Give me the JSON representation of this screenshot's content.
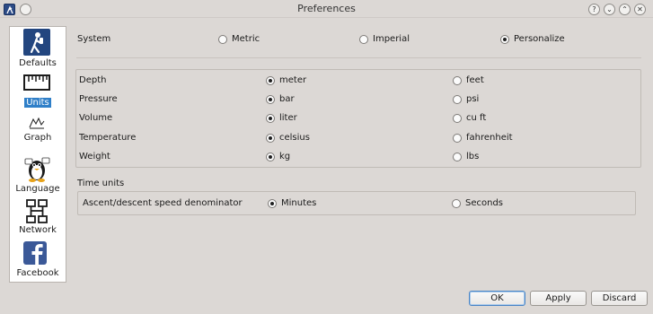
{
  "window": {
    "title": "Preferences",
    "controls": {
      "help": "?",
      "shade": "⌄",
      "maximize": "⌃",
      "close": "✕"
    }
  },
  "sidebar": {
    "items": [
      {
        "label": "Defaults",
        "icon": "diver-icon"
      },
      {
        "label": "Units",
        "icon": "ruler-icon",
        "selected": true
      },
      {
        "label": "Graph",
        "icon": "graph-icon"
      },
      {
        "label": "Language",
        "icon": "penguin-icon"
      },
      {
        "label": "Network",
        "icon": "network-icon"
      },
      {
        "label": "Facebook",
        "icon": "facebook-icon"
      }
    ]
  },
  "system": {
    "label": "System",
    "options": [
      {
        "label": "Metric",
        "checked": false
      },
      {
        "label": "Imperial",
        "checked": false
      },
      {
        "label": "Personalize",
        "checked": true
      }
    ]
  },
  "units": {
    "rows": [
      {
        "label": "Depth",
        "metric": "meter",
        "imperial": "feet",
        "selected": "metric"
      },
      {
        "label": "Pressure",
        "metric": "bar",
        "imperial": "psi",
        "selected": "metric"
      },
      {
        "label": "Volume",
        "metric": "liter",
        "imperial": "cu ft",
        "selected": "metric"
      },
      {
        "label": "Temperature",
        "metric": "celsius",
        "imperial": "fahrenheit",
        "selected": "metric"
      },
      {
        "label": "Weight",
        "metric": "kg",
        "imperial": "lbs",
        "selected": "metric"
      }
    ]
  },
  "time_units": {
    "title": "Time units",
    "row_label": "Ascent/descent speed denominator",
    "options": [
      {
        "label": "Minutes",
        "checked": true
      },
      {
        "label": "Seconds",
        "checked": false
      }
    ]
  },
  "buttons": {
    "ok": "OK",
    "apply": "Apply",
    "discard": "Discard"
  },
  "colors": {
    "selection": "#2f7fc8",
    "window_bg": "#dcd8d5",
    "default_button_border": "#4a85c6"
  }
}
